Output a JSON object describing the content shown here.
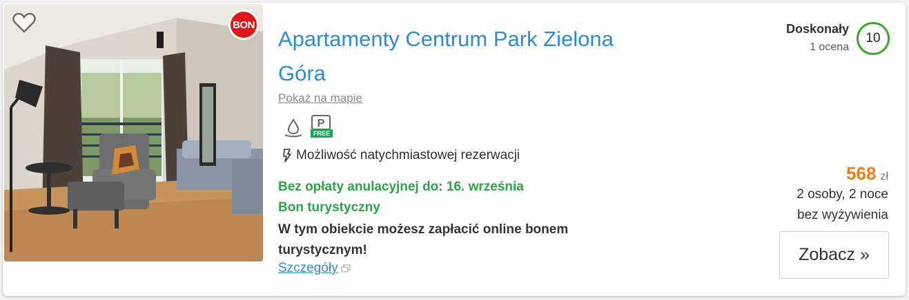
{
  "listing": {
    "title": "Apartamenty Centrum Park Zielona Góra",
    "map_link": "Pokaż na mapie",
    "badge": "BON",
    "amenities": [
      {
        "icon": "water-drop-icon"
      },
      {
        "icon": "parking-icon",
        "tag": "FREE"
      }
    ],
    "instant_booking": "Możliwość natychmiastowej rezerwacji",
    "free_cancellation": "Bez opłaty anulacyjnej do: 16. września",
    "voucher_label": "Bon turystyczny",
    "voucher_text": "W tym obiekcie możesz zapłacić online bonem turystycznym!",
    "details_link": "Szczegóły"
  },
  "rating": {
    "label": "Doskonały",
    "count": "1 ocena",
    "score": "10"
  },
  "price": {
    "value": "568",
    "currency": "zł",
    "line1": "2 osoby, 2 noce",
    "line2": "bez wyżywienia"
  },
  "actions": {
    "see_label": "Zobacz »"
  },
  "colors": {
    "title_blue": "#2d8ad6",
    "green": "#2aa645",
    "price_orange": "#f47b20",
    "badge_red": "#e1141b",
    "score_ring": "#3aa62f"
  }
}
